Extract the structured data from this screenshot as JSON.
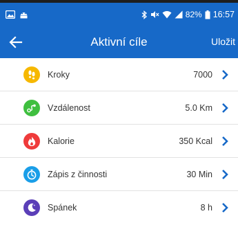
{
  "statusbar": {
    "battery_percent": "82%",
    "time": "16:57"
  },
  "appbar": {
    "title": "Aktivní cíle",
    "save_label": "Uložit"
  },
  "goals": [
    {
      "label": "Kroky",
      "value": "7000",
      "icon": "footsteps-icon",
      "color": "#f6b800"
    },
    {
      "label": "Vzdálenost",
      "value": "5.0 Km",
      "icon": "route-icon",
      "color": "#3fbf3f"
    },
    {
      "label": "Kalorie",
      "value": "350 Kcal",
      "icon": "flame-icon",
      "color": "#ef3b3b"
    },
    {
      "label": "Zápis z činnosti",
      "value": "30 Min",
      "icon": "stopwatch-icon",
      "color": "#1a9ee8"
    },
    {
      "label": "Spánek",
      "value": "8 h",
      "icon": "moon-icon",
      "color": "#5b3fb8"
    }
  ],
  "colors": {
    "primary": "#1769c8",
    "chevron": "#1769c8"
  }
}
